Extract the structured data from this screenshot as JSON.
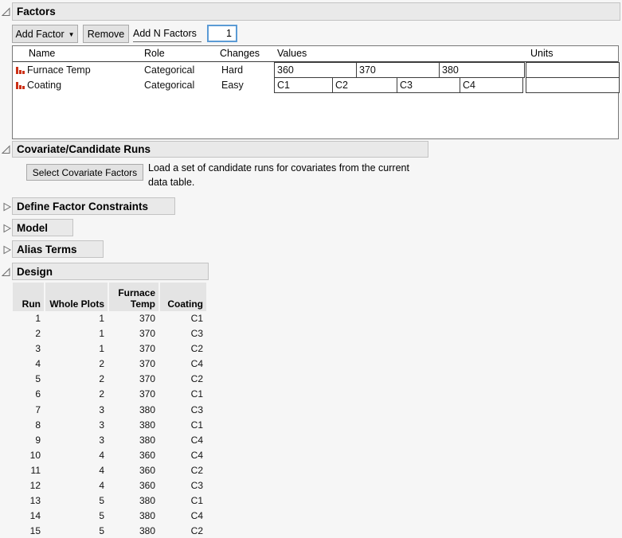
{
  "icons": {
    "dropdown_caret": "▼"
  },
  "factors": {
    "title": "Factors",
    "toolbar": {
      "add_factor": "Add Factor",
      "remove": "Remove",
      "add_n_factors": "Add N Factors",
      "n_value": "1"
    },
    "table": {
      "headers": {
        "name": "Name",
        "role": "Role",
        "changes": "Changes",
        "values": "Values",
        "units": "Units"
      },
      "rows": [
        {
          "name": "Furnace Temp",
          "role": "Categorical",
          "changes": "Hard",
          "values": [
            "360",
            "370",
            "380"
          ],
          "units": ""
        },
        {
          "name": "Coating",
          "role": "Categorical",
          "changes": "Easy",
          "values": [
            "C1",
            "C2",
            "C3",
            "C4"
          ],
          "units": ""
        }
      ]
    }
  },
  "covariate": {
    "title": "Covariate/Candidate Runs",
    "button": "Select Covariate Factors",
    "desc_line1": "Load a set of candidate runs for covariates from the current",
    "desc_line2": "data table."
  },
  "sections": {
    "constraints": "Define Factor Constraints",
    "model": "Model",
    "alias": "Alias Terms",
    "design": "Design"
  },
  "design": {
    "headers": [
      "Run",
      "Whole Plots",
      "Furnace Temp",
      "Coating"
    ],
    "rows": [
      {
        "run": "1",
        "whole_plot": "1",
        "furnace_temp": "370",
        "coating": "C1"
      },
      {
        "run": "2",
        "whole_plot": "1",
        "furnace_temp": "370",
        "coating": "C3"
      },
      {
        "run": "3",
        "whole_plot": "1",
        "furnace_temp": "370",
        "coating": "C2"
      },
      {
        "run": "4",
        "whole_plot": "2",
        "furnace_temp": "370",
        "coating": "C4"
      },
      {
        "run": "5",
        "whole_plot": "2",
        "furnace_temp": "370",
        "coating": "C2"
      },
      {
        "run": "6",
        "whole_plot": "2",
        "furnace_temp": "370",
        "coating": "C1"
      },
      {
        "run": "7",
        "whole_plot": "3",
        "furnace_temp": "380",
        "coating": "C3"
      },
      {
        "run": "8",
        "whole_plot": "3",
        "furnace_temp": "380",
        "coating": "C1"
      },
      {
        "run": "9",
        "whole_plot": "3",
        "furnace_temp": "380",
        "coating": "C4"
      },
      {
        "run": "10",
        "whole_plot": "4",
        "furnace_temp": "360",
        "coating": "C4"
      },
      {
        "run": "11",
        "whole_plot": "4",
        "furnace_temp": "360",
        "coating": "C2"
      },
      {
        "run": "12",
        "whole_plot": "4",
        "furnace_temp": "360",
        "coating": "C3"
      },
      {
        "run": "13",
        "whole_plot": "5",
        "furnace_temp": "380",
        "coating": "C1"
      },
      {
        "run": "14",
        "whole_plot": "5",
        "furnace_temp": "380",
        "coating": "C4"
      },
      {
        "run": "15",
        "whole_plot": "5",
        "furnace_temp": "380",
        "coating": "C2"
      }
    ]
  }
}
